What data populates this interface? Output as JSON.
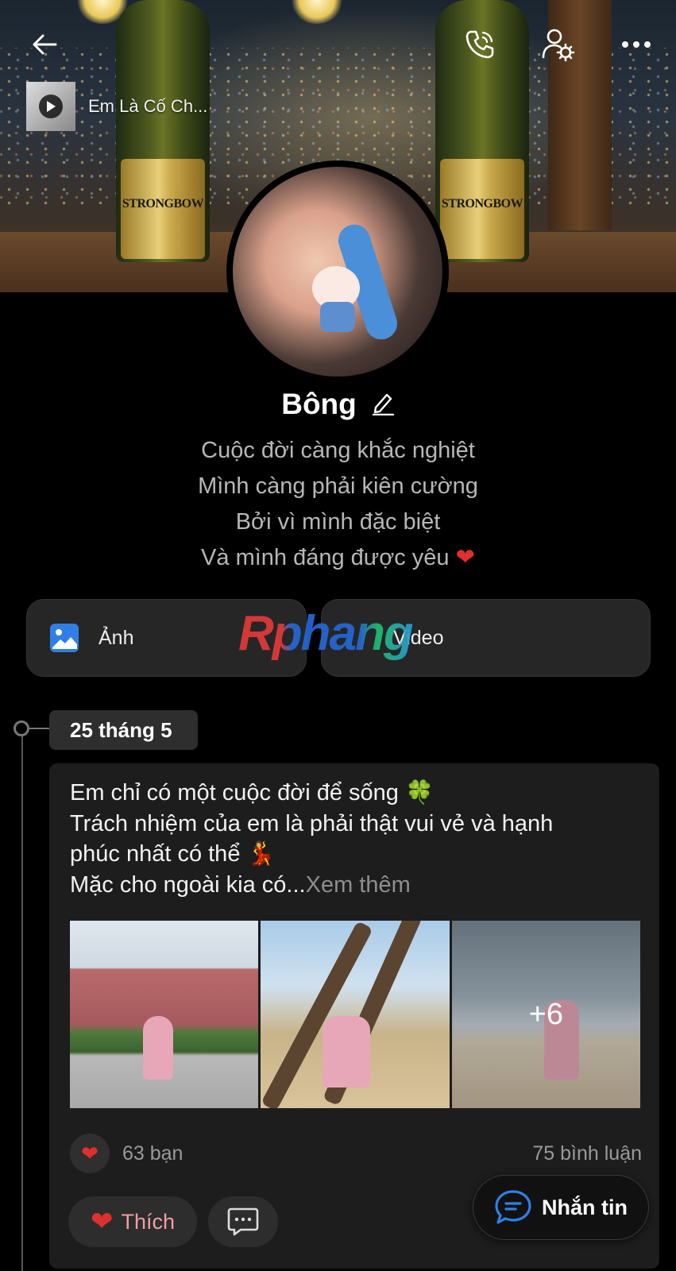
{
  "header": {
    "music_title": "Em Là Cố Ch..."
  },
  "cover": {
    "bottle_label": "STRONGBOW"
  },
  "profile": {
    "name": "Bông",
    "bio": [
      "Cuộc đời càng khắc nghiệt",
      "Mình càng phải kiên cường",
      "Bởi vì mình đặc biệt",
      "Và mình đáng được yêu"
    ],
    "bio_heart": "❤"
  },
  "tabs": [
    {
      "label": "Ảnh",
      "icon": "image-icon"
    },
    {
      "label": "Video",
      "icon": "video-icon"
    }
  ],
  "watermark": "Rphang",
  "timeline": {
    "date": "25 tháng 5"
  },
  "post": {
    "text_lines": [
      "Em chỉ có một cuộc đời để sống 🍀",
      "Trách nhiệm của em là phải thật vui vẻ và hạnh",
      "phúc nhất có thể 💃",
      "Mặc cho ngoài kia có..."
    ],
    "see_more": "Xem thêm",
    "photos_more": "+6",
    "reaction_count": "63 bạn",
    "comment_count": "75 bình luận",
    "like_label": "Thích"
  },
  "fab": {
    "message_label": "Nhắn tin"
  },
  "colors": {
    "background": "#000000",
    "card": "#1d1d1d",
    "heart": "#e0302e",
    "accent_blue": "#2f7fe6",
    "like_text": "#f09fa3"
  }
}
